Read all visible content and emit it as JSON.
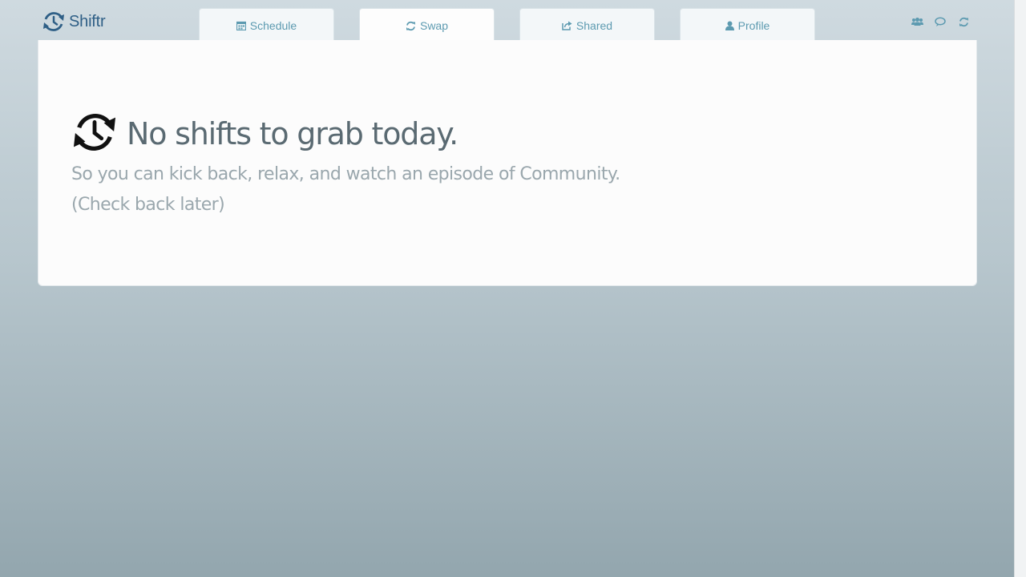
{
  "app": {
    "brand_name": "Shiftr",
    "brand_color": "#2f5f86",
    "accent_color": "#5c9ab0"
  },
  "nav": {
    "tabs": [
      {
        "label": "Schedule",
        "icon": "calendar-icon",
        "active": false
      },
      {
        "label": "Swap",
        "icon": "refresh-icon",
        "active": true
      },
      {
        "label": "Shared",
        "icon": "share-icon",
        "active": false
      },
      {
        "label": "Profile",
        "icon": "user-icon",
        "active": false
      }
    ],
    "action_icons": [
      "group-icon",
      "chat-icon",
      "refresh-icon"
    ]
  },
  "empty_state": {
    "icon": "clock-history-icon",
    "title": "No shifts to grab today.",
    "message": "So you can kick back, relax, and watch an episode of Community.",
    "hint": "(Check back later)"
  }
}
